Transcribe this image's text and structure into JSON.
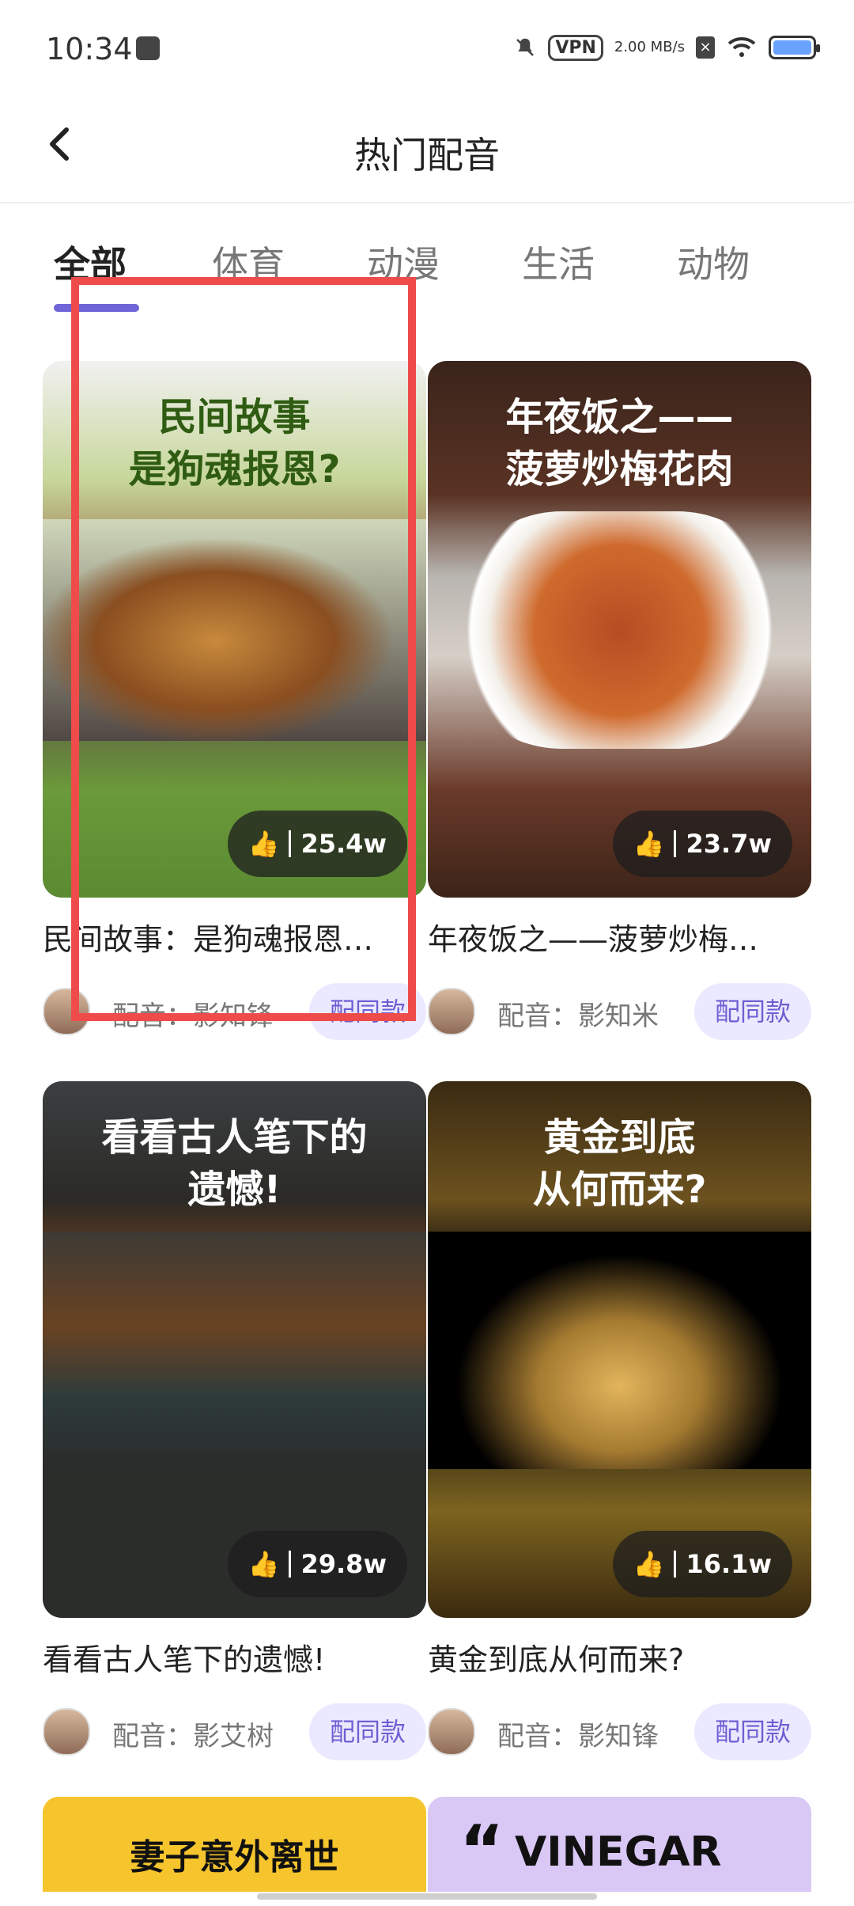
{
  "status_bar": {
    "time": "10:34",
    "vpn": "VPN",
    "speed": "2.00\nMB/s"
  },
  "header": {
    "title": "热门配音"
  },
  "tabs": [
    "全部",
    "体育",
    "动漫",
    "生活",
    "动物"
  ],
  "cards": [
    {
      "cover_text_line1": "民间故事",
      "cover_text_line2": "是狗魂报恩?",
      "likes": "25.4w",
      "caption": "民间故事：是狗魂报恩…",
      "voice": "配音：影知锋",
      "button": "配同款"
    },
    {
      "cover_text_line1": "年夜饭之——",
      "cover_text_line2": "菠萝炒梅花肉",
      "likes": "23.7w",
      "caption": "年夜饭之——菠萝炒梅…",
      "voice": "配音：影知米",
      "button": "配同款"
    },
    {
      "cover_text_line1": "看看古人笔下的",
      "cover_text_line2": "遗憾!",
      "likes": "29.8w",
      "caption": "看看古人笔下的遗憾!",
      "voice": "配音：影艾树",
      "button": "配同款"
    },
    {
      "cover_text_line1": "黄金到底",
      "cover_text_line2": "从何而来?",
      "likes": "16.1w",
      "caption": "黄金到底从何而来?",
      "voice": "配音：影知锋",
      "button": "配同款"
    }
  ],
  "peek": {
    "left_text": "妻子意外离世",
    "right_text": "VINEGAR",
    "right_quote": "“"
  },
  "colors": {
    "accent": "#6f64d8",
    "button_bg": "#ebe9ff",
    "button_text": "#6d5fd3",
    "highlight_box": "#ef4b4b"
  }
}
